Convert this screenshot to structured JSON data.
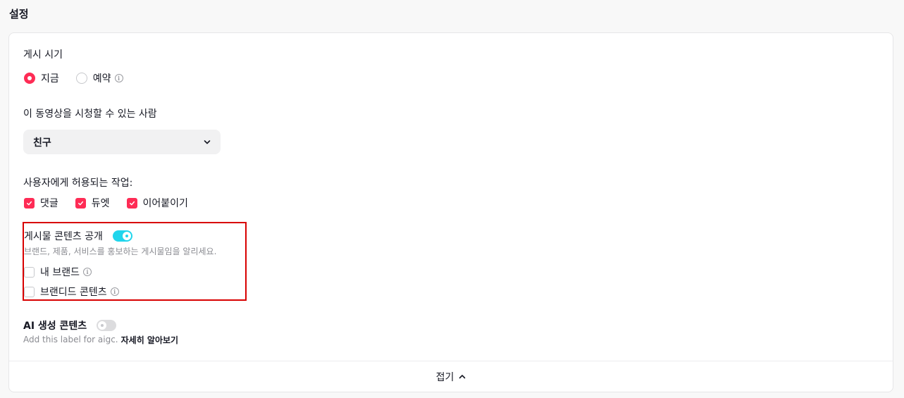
{
  "section_title": "설정",
  "post_timing": {
    "label": "게시 시기",
    "options": [
      {
        "label": "지금",
        "selected": true
      },
      {
        "label": "예약",
        "selected": false,
        "has_info": true
      }
    ]
  },
  "audience": {
    "label": "이 동영상을 시청할 수 있는 사람",
    "selected": "친구"
  },
  "allowed_actions": {
    "label": "사용자에게 허용되는 작업:",
    "items": [
      {
        "label": "댓글",
        "checked": true
      },
      {
        "label": "듀엣",
        "checked": true
      },
      {
        "label": "이어붙이기",
        "checked": true
      }
    ]
  },
  "content_disclosure": {
    "label": "게시물 콘텐츠 공개",
    "enabled": true,
    "description": "브랜드, 제품, 서비스를 홍보하는 게시물임을 알리세요.",
    "options": [
      {
        "label": "내 브랜드",
        "checked": false,
        "has_info": true
      },
      {
        "label": "브랜디드 콘텐츠",
        "checked": false,
        "has_info": true
      }
    ]
  },
  "ai_content": {
    "label": "AI 생성 콘텐츠",
    "enabled": false,
    "description": "Add this label for aigc.",
    "link": "자세히 알아보기"
  },
  "collapse_label": "접기",
  "colors": {
    "accent": "#fe2c55",
    "toggle_on": "#20d5ec",
    "highlight": "#d80000"
  }
}
